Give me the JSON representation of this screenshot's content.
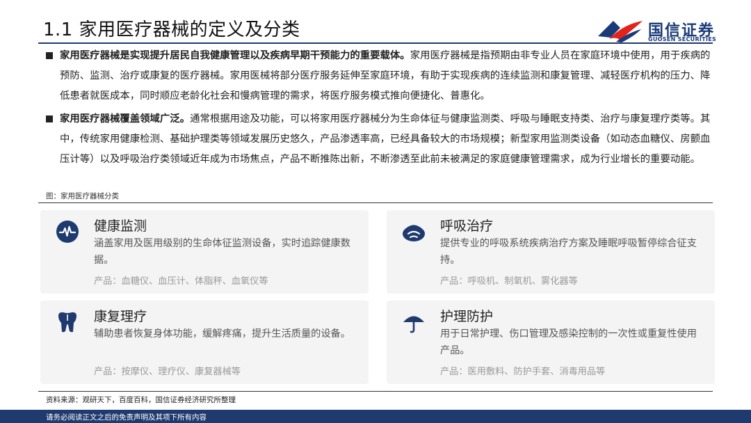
{
  "header": {
    "title": "1.1 家用医疗器械的定义及分类",
    "logo_cn": "国信证券",
    "logo_en": "GUOSEN SECURITIES",
    "logo_colors": {
      "red": "#e2231a",
      "blue": "#1a3a78"
    }
  },
  "paragraphs": [
    {
      "bold": "家用医疗器械是实现提升居民自我健康管理以及疾病早期干预能力的重要载体。",
      "text": "家用医疗器械是指预期由非专业人员在家庭环境中使用，用于疾病的预防、监测、治疗或康复的医疗器械。家用医械将部分医疗服务延伸至家庭环境，有助于实现疾病的连续监测和康复管理、减轻医疗机构的压力、降低患者就医成本，同时顺应老龄化社会和慢病管理的需求，将医疗服务模式推向便捷化、普惠化。"
    },
    {
      "bold": "家用医疗器械覆盖领域广泛。",
      "text": "通常根据用途及功能，可以将家用医疗器械分为生命体征与健康监测类、呼吸与睡眠支持类、治疗与康复理疗类等。其中，传统家用健康检测、基础护理类等领域发展历史悠久，产品渗透率高，已经具备较大的市场规模；新型家用监测类设备（如动态血糖仪、房颤血压计等）以及呼吸治疗类领域近年成为市场焦点，产品不断推陈出新，不断渗透至此前未被满足的家庭健康管理需求，成为行业增长的重要动能。"
    }
  ],
  "figure": {
    "label": "图：家用医疗器械分类",
    "icon_color": "#1f3a6e",
    "categories": [
      {
        "icon": "heartbeat-icon",
        "title": "健康监测",
        "desc": "涵盖家用及医用级别的生命体征监测设备，实时追踪健康数据。",
        "products": "产品：血糖仪、血压计、体脂秤、血氧仪等"
      },
      {
        "icon": "lungs-icon",
        "title": "呼吸治疗",
        "desc": "提供专业的呼吸系统疾病治疗方案及睡眠呼吸暂停综合征支持。",
        "products": "产品：呼吸机、制氧机、雾化器等"
      },
      {
        "icon": "tooth-icon",
        "title": "康复理疗",
        "desc": "辅助患者恢复身体功能，缓解疼痛，提升生活质量的设备。",
        "products": "产品：按摩仪、理疗仪、康复器械等"
      },
      {
        "icon": "umbrella-icon",
        "title": "护理防护",
        "desc": "用于日常护理、伤口管理及感染控制的一次性或重复性使用产品。",
        "products": "产品：医用敷料、防护手套、消毒用品等"
      }
    ]
  },
  "source": "资料来源：观研天下，百度百科，国信证券经济研究所整理",
  "footer": "请务必阅读正文之后的免责声明及其项下所有内容"
}
